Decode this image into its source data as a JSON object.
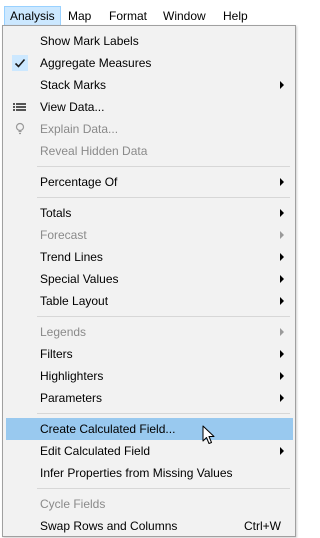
{
  "menubar": {
    "items": [
      {
        "label": "Analysis"
      },
      {
        "label": "Map"
      },
      {
        "label": "Format"
      },
      {
        "label": "Window"
      },
      {
        "label": "Help"
      }
    ]
  },
  "menu": {
    "items": [
      {
        "label": "Show Mark Labels"
      },
      {
        "label": "Aggregate Measures",
        "icon": "checkmark-icon",
        "checked": true
      },
      {
        "label": "Stack Marks",
        "submenu": true
      },
      {
        "label": "View Data...",
        "icon": "table-icon"
      },
      {
        "label": "Explain Data...",
        "icon": "lightbulb-icon",
        "disabled": true
      },
      {
        "label": "Reveal Hidden Data",
        "disabled": true
      },
      {
        "label": "Percentage Of",
        "submenu": true
      },
      {
        "label": "Totals",
        "submenu": true
      },
      {
        "label": "Forecast",
        "submenu": true,
        "disabled": true
      },
      {
        "label": "Trend Lines",
        "submenu": true
      },
      {
        "label": "Special Values",
        "submenu": true
      },
      {
        "label": "Table Layout",
        "submenu": true
      },
      {
        "label": "Legends",
        "submenu": true,
        "disabled": true
      },
      {
        "label": "Filters",
        "submenu": true
      },
      {
        "label": "Highlighters",
        "submenu": true
      },
      {
        "label": "Parameters",
        "submenu": true
      },
      {
        "label": "Create Calculated Field...",
        "highlighted": true
      },
      {
        "label": "Edit Calculated Field",
        "submenu": true
      },
      {
        "label": "Infer Properties from Missing Values"
      },
      {
        "label": "Cycle Fields",
        "disabled": true
      },
      {
        "label": "Swap Rows and Columns",
        "shortcut": "Ctrl+W"
      }
    ]
  },
  "colors": {
    "highlight": "#99c9ef",
    "active_menu": "#cce8ff",
    "disabled_text": "#8a8a8a",
    "menu_background": "#f2f2f2",
    "check_background": "#cce8ff"
  }
}
